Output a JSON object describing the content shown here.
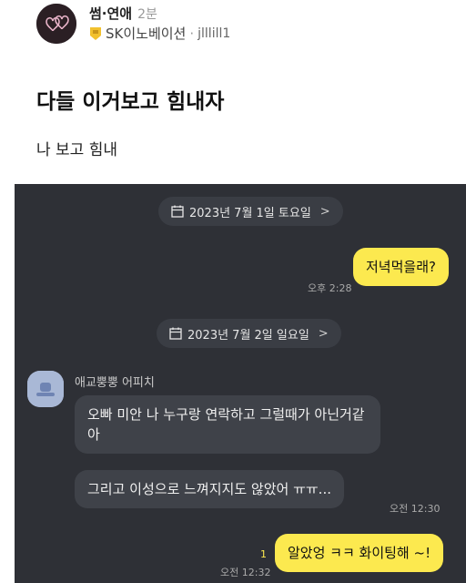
{
  "post": {
    "category": "썸·연애",
    "time": "2분",
    "company": "SK이노베이션",
    "separator": "·",
    "nickname": "jlllill1",
    "title": "다들 이거보고 힘내자",
    "body": "나 보고 힘내"
  },
  "chat": {
    "date1": "2023년 7월 1일 토요일",
    "date2": "2023년 7월 2일 일요일",
    "chevron": ">",
    "msg1": {
      "text": "저녁먹을래?",
      "time": "오후 2:28"
    },
    "friend_name": "애교뿡뿡 어피치",
    "msg2": {
      "text": "오빠 미안 나 누구랑 연락하고 그럴때가 아닌거같아"
    },
    "msg3": {
      "text": "그리고 이성으로 느껴지지도 않았어 ㅠㅠ...",
      "time": "오전 12:30"
    },
    "msg4": {
      "text": "알았엉 ㅋㅋ 화이팅해 ~!",
      "time": "오전 12:32",
      "unread": "1"
    },
    "colors": {
      "my_bubble": "#fce94f",
      "their_bubble": "#3f4249",
      "chat_bg": "#2e3036"
    }
  }
}
